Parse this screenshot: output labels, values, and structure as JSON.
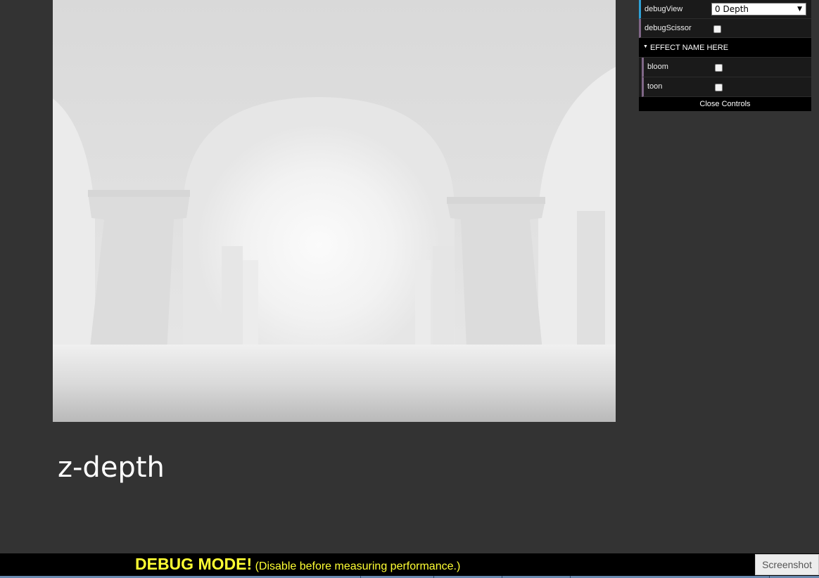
{
  "gui": {
    "rows": [
      {
        "label": "debugView",
        "type": "select",
        "value": "0 Depth"
      },
      {
        "label": "debugScissor",
        "type": "checkbox",
        "checked": false
      }
    ],
    "folder": {
      "title": "EFFECT NAME HERE",
      "expanded": true,
      "items": [
        {
          "label": "bloom",
          "type": "checkbox",
          "checked": false
        },
        {
          "label": "toon",
          "type": "checkbox",
          "checked": false
        }
      ]
    },
    "close_label": "Close Controls"
  },
  "caption": "z-depth",
  "debug": {
    "title": "DEBUG MODE!",
    "subtitle": "(Disable before measuring performance.)",
    "screenshot_label": "Screenshot"
  },
  "colors": {
    "page_bg": "#333333",
    "banner_bg": "#000000",
    "banner_text": "#ffff33",
    "gui_accent_blue": "#2fa1d6",
    "gui_accent_purple": "#806787"
  },
  "icons": {
    "folder_toggle": "triangle-down-icon",
    "select_arrow": "chevron-down-icon"
  }
}
